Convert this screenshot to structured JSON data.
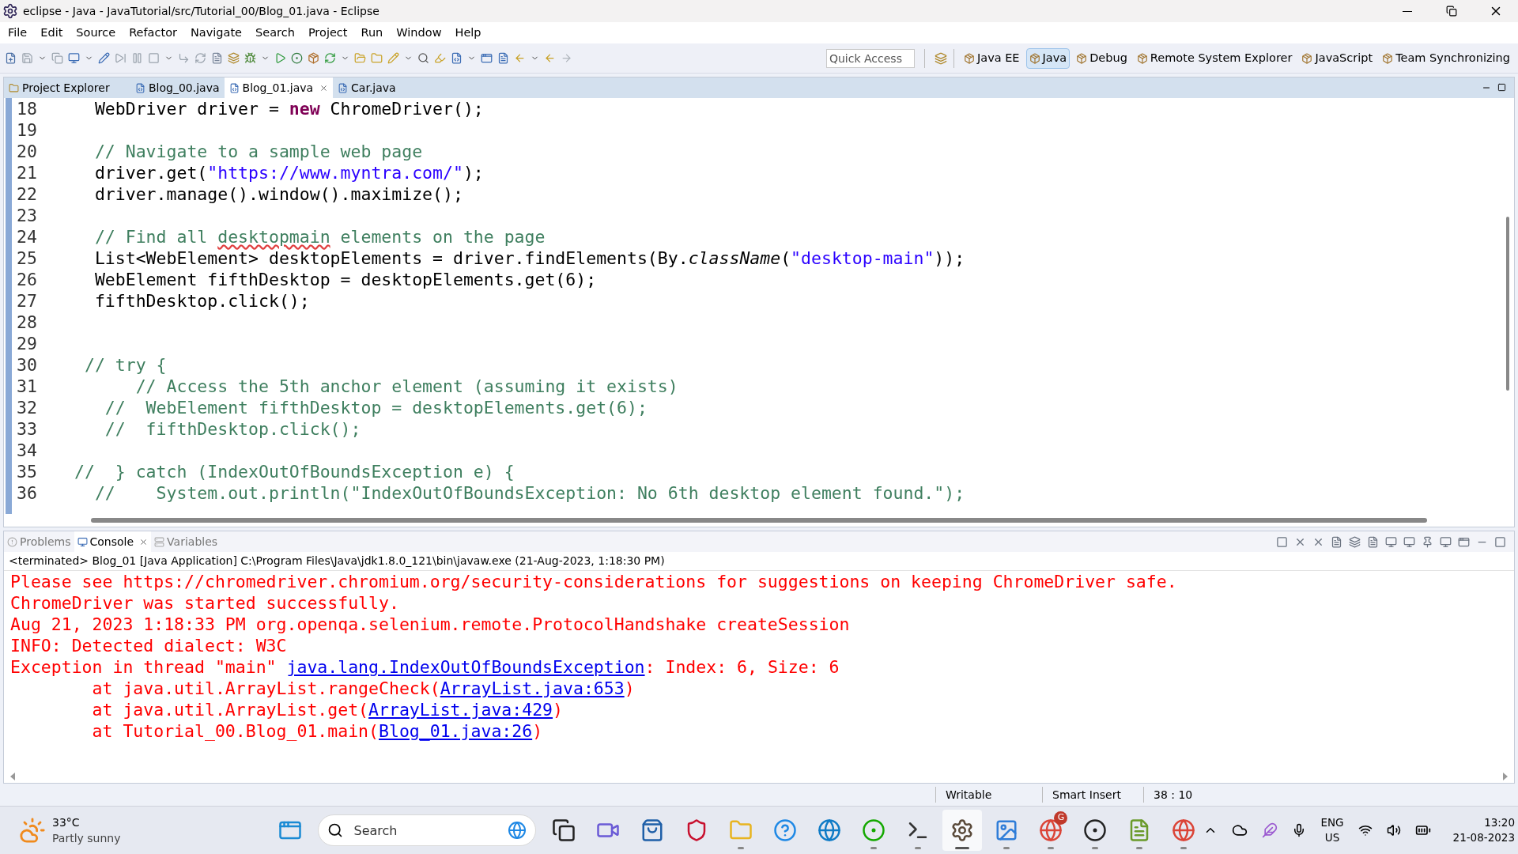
{
  "window": {
    "title": "eclipse - Java - JavaTutorial/src/Tutorial_00/Blog_01.java - Eclipse"
  },
  "menu": [
    "File",
    "Edit",
    "Source",
    "Refactor",
    "Navigate",
    "Search",
    "Project",
    "Run",
    "Window",
    "Help"
  ],
  "quick_access": {
    "placeholder": "Quick Access"
  },
  "perspectives": [
    {
      "label": "Java EE",
      "selected": false
    },
    {
      "label": "Java",
      "selected": true
    },
    {
      "label": "Debug",
      "selected": false
    },
    {
      "label": "Remote System Explorer",
      "selected": false
    },
    {
      "label": "JavaScript",
      "selected": false
    },
    {
      "label": "Team Synchronizing",
      "selected": false
    }
  ],
  "editor_tabs": [
    {
      "label": "Project Explorer",
      "kind": "view",
      "selected": false
    },
    {
      "label": "Blog_00.java",
      "kind": "file",
      "selected": false
    },
    {
      "label": "Blog_01.java",
      "kind": "file",
      "selected": true
    },
    {
      "label": "Car.java",
      "kind": "file",
      "selected": false
    }
  ],
  "code": [
    {
      "number": "18",
      "segments": [
        {
          "text": "  WebDriver driver = ",
          "kind": "plain"
        },
        {
          "text": "new",
          "kind": "keyword"
        },
        {
          "text": " ChromeDriver();",
          "kind": "plain"
        }
      ]
    },
    {
      "number": "19"
    },
    {
      "number": "20",
      "segments": [
        {
          "text": "  // Navigate to a sample web page",
          "kind": "comment"
        }
      ]
    },
    {
      "number": "21",
      "segments": [
        {
          "text": "  driver.get(",
          "kind": "plain"
        },
        {
          "text": "\"https://www.myntra.com/\"",
          "kind": "string"
        },
        {
          "text": ");",
          "kind": "plain"
        }
      ]
    },
    {
      "number": "22",
      "segments": [
        {
          "text": "  driver.manage().window().maximize();",
          "kind": "plain"
        }
      ]
    },
    {
      "number": "23"
    },
    {
      "number": "24",
      "segments": [
        {
          "text": "  // Find all ",
          "kind": "comment"
        },
        {
          "text": "desktopmain",
          "kind": "misspelled"
        },
        {
          "text": " elements on the page",
          "kind": "comment"
        }
      ]
    },
    {
      "number": "25",
      "segments": [
        {
          "text": "  List<WebElement> desktopElements = driver.findElements(By.",
          "kind": "plain"
        },
        {
          "text": "className",
          "kind": "static"
        },
        {
          "text": "(",
          "kind": "plain"
        },
        {
          "text": "\"desktop-main\"",
          "kind": "string"
        },
        {
          "text": "));",
          "kind": "plain"
        }
      ]
    },
    {
      "number": "26",
      "segments": [
        {
          "text": "  WebElement fifthDesktop = desktopElements.get(6);",
          "kind": "plain"
        }
      ]
    },
    {
      "number": "27",
      "segments": [
        {
          "text": "  fifthDesktop.click();",
          "kind": "plain"
        }
      ]
    },
    {
      "number": "28"
    },
    {
      "number": "29"
    },
    {
      "number": "30",
      "segments": [
        {
          "text": " // try {",
          "kind": "comment"
        }
      ]
    },
    {
      "number": "31",
      "segments": [
        {
          "text": "      // Access the 5th anchor element (assuming it exists)",
          "kind": "comment"
        }
      ]
    },
    {
      "number": "32",
      "segments": [
        {
          "text": "   //  WebElement fifthDesktop = desktopElements.get(6);",
          "kind": "comment"
        }
      ]
    },
    {
      "number": "33",
      "segments": [
        {
          "text": "   //  fifthDesktop.click();",
          "kind": "comment"
        }
      ]
    },
    {
      "number": "34"
    },
    {
      "number": "35",
      "segments": [
        {
          "text": "//  } catch (IndexOutOfBoundsException e) {",
          "kind": "comment"
        }
      ]
    },
    {
      "number": "36",
      "segments": [
        {
          "text": "  //    System.out.println(\"IndexOutOfBoundsException: No 6th desktop element found.\");",
          "kind": "comment"
        }
      ]
    }
  ],
  "console_tabs": [
    {
      "label": "Problems",
      "kind": "problems",
      "selected": false
    },
    {
      "label": "Console",
      "kind": "console",
      "selected": true
    },
    {
      "label": "Variables",
      "kind": "variables",
      "selected": false
    }
  ],
  "console_header": "<terminated> Blog_01 [Java Application] C:\\Program Files\\Java\\jdk1.8.0_121\\bin\\javaw.exe (21-Aug-2023, 1:18:30 PM)",
  "console": [
    [
      {
        "text": "Please see https://chromedriver.chromium.org/security-considerations for suggestions on keeping ChromeDriver safe.",
        "kind": "error"
      }
    ],
    [
      {
        "text": "ChromeDriver was started successfully.",
        "kind": "error"
      }
    ],
    [
      {
        "text": "Aug 21, 2023 1:18:33 PM org.openqa.selenium.remote.ProtocolHandshake createSession",
        "kind": "error"
      }
    ],
    [
      {
        "text": "INFO: Detected dialect: W3C",
        "kind": "error"
      }
    ],
    [
      {
        "text": "Exception in thread \"main\" ",
        "kind": "error"
      },
      {
        "text": "java.lang.IndexOutOfBoundsException",
        "kind": "link"
      },
      {
        "text": ": Index: 6, Size: 6",
        "kind": "error"
      }
    ],
    [
      {
        "text": "\tat java.util.ArrayList.rangeCheck(",
        "kind": "error"
      },
      {
        "text": "ArrayList.java:653",
        "kind": "link"
      },
      {
        "text": ")",
        "kind": "error"
      }
    ],
    [
      {
        "text": "\tat java.util.ArrayList.get(",
        "kind": "error"
      },
      {
        "text": "ArrayList.java:429",
        "kind": "link"
      },
      {
        "text": ")",
        "kind": "error"
      }
    ],
    [
      {
        "text": "\tat Tutorial_00.Blog_01.main(",
        "kind": "error"
      },
      {
        "text": "Blog_01.java:26",
        "kind": "link"
      },
      {
        "text": ")",
        "kind": "error"
      }
    ]
  ],
  "status_bar": [
    "Writable",
    "Smart Insert",
    "38 : 10"
  ],
  "taskbar": {
    "weather": {
      "temperature": "33°C",
      "condition": "Partly sunny"
    },
    "search": {
      "placeholder": "Search"
    },
    "apps": [
      {
        "kind": "windows",
        "running": false,
        "selected": false
      },
      {
        "kind": "taskview",
        "running": false,
        "selected": false
      },
      {
        "kind": "meet",
        "running": false,
        "selected": false
      },
      {
        "kind": "store",
        "running": false,
        "selected": false
      },
      {
        "kind": "shield",
        "running": false,
        "selected": false
      },
      {
        "kind": "folder",
        "running": true,
        "selected": false
      },
      {
        "kind": "help",
        "running": false,
        "selected": false
      },
      {
        "kind": "edge",
        "running": false,
        "selected": false
      },
      {
        "kind": "upwork",
        "running": true,
        "selected": false
      },
      {
        "kind": "terminal",
        "running": true,
        "selected": false
      },
      {
        "kind": "gear",
        "running": true,
        "selected": true
      },
      {
        "kind": "photos",
        "running": true,
        "selected": false
      },
      {
        "kind": "chrome",
        "running": true,
        "selected": false,
        "badge": "G"
      },
      {
        "kind": "obs",
        "running": true,
        "selected": false
      },
      {
        "kind": "notepad",
        "running": true,
        "selected": false
      },
      {
        "kind": "chrome",
        "running": true,
        "selected": false
      }
    ],
    "language": [
      "ENG",
      "US"
    ],
    "time": "13:20",
    "date": "21-08-2023"
  }
}
